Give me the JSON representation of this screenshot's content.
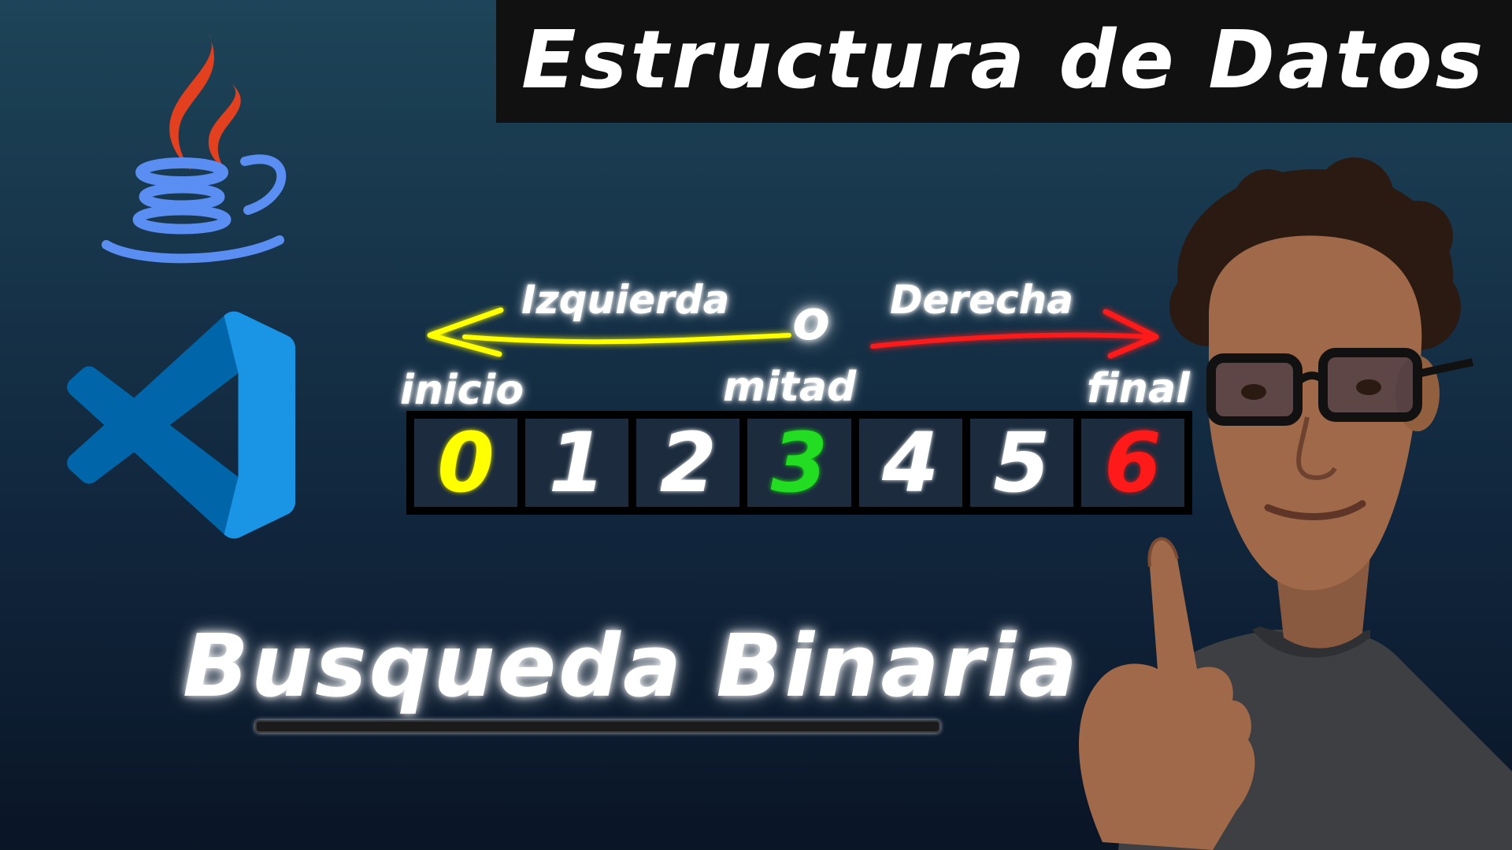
{
  "title": "Estructura de Datos",
  "subtitle": "Busqueda Binaria",
  "direction_labels": {
    "left": "Izquierda",
    "or": "o",
    "right": "Derecha"
  },
  "pointer_labels": {
    "start": "inicio",
    "middle": "mitad",
    "end": "final"
  },
  "array_values": [
    "0",
    "1",
    "2",
    "3",
    "4",
    "5",
    "6"
  ],
  "colors": {
    "start": "#ffff00",
    "middle": "#22dd22",
    "end": "#ff1a1a",
    "left_arrow": "#ffff00",
    "right_arrow": "#ff1a1a",
    "banner": "#111111"
  },
  "icons": [
    "java-logo-icon",
    "vscode-logo-icon",
    "left-arrow-icon",
    "right-arrow-icon"
  ]
}
